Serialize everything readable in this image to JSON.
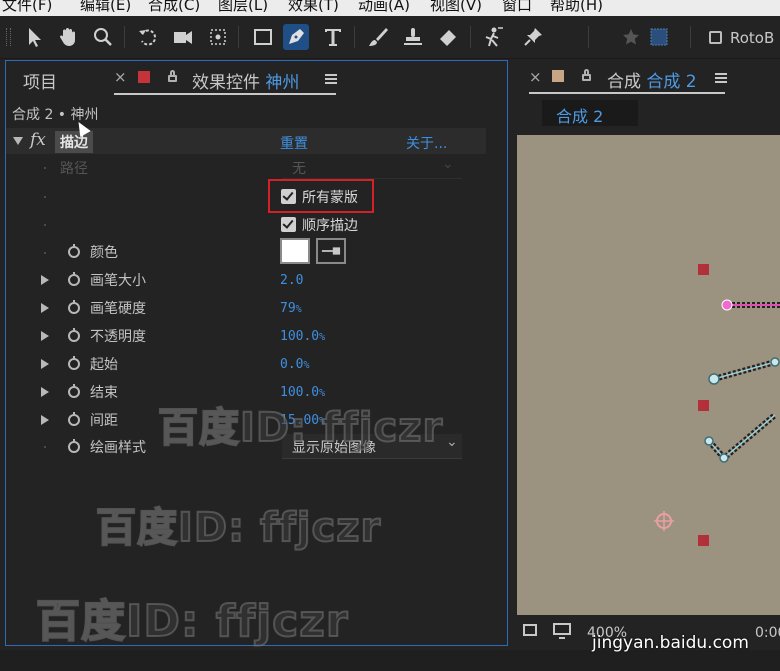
{
  "menubar": {
    "items": [
      "文件(F)",
      "编辑(E)",
      "合成(C)",
      "图层(L)",
      "效果(T)",
      "动画(A)",
      "视图(V)",
      "窗口",
      "帮助(H)"
    ]
  },
  "toolbar": {
    "roto_label": "RotoB"
  },
  "left_panel": {
    "tab_project": "项目",
    "tab_close": "×",
    "tab_effects_prefix": "效果控件",
    "tab_effects_layer": "神州",
    "breadcrumb": "合成 2 • 神州",
    "effect": {
      "fx": "fx",
      "name": "描边",
      "reset": "重置",
      "about": "关于..."
    },
    "path_label": "路径",
    "path_value": "无",
    "all_masks_label": "所有蒙版",
    "sequential_label": "顺序描边",
    "properties": [
      {
        "label": "颜色"
      },
      {
        "label": "画笔大小",
        "value": "2.0",
        "unit": ""
      },
      {
        "label": "画笔硬度",
        "value": "79",
        "unit": "%"
      },
      {
        "label": "不透明度",
        "value": "100.0",
        "unit": "%"
      },
      {
        "label": "起始",
        "value": "0.0",
        "unit": "%"
      },
      {
        "label": "结束",
        "value": "100.0",
        "unit": "%"
      },
      {
        "label": "间距",
        "value": "15.00",
        "unit": "%"
      }
    ],
    "paint_style_label": "绘画样式",
    "paint_style_value": "显示原始图像"
  },
  "right_panel": {
    "tab_close": "×",
    "tab_prefix": "合成",
    "tab_comp": "合成 2",
    "comp_chip": "合成 2",
    "zoom": "400%",
    "timecode": "0:00"
  },
  "watermarks": [
    "百度ID: ffjczr",
    "百度ID: ffjczr",
    "百度ID: ffjczr"
  ],
  "source_watermark": "jingyan.baidu.com",
  "colors": {
    "accent_blue": "#2d6bb8",
    "value_blue": "#3f8fe0",
    "highlight_red": "#d42027",
    "viewer_bg": "#9c9280"
  }
}
